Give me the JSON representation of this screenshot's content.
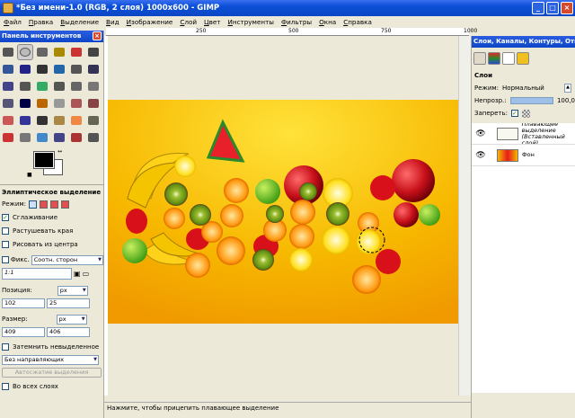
{
  "window": {
    "title": "*Без имени-1.0 (RGB, 2 слоя) 1000x600 - GIMP"
  },
  "menu": [
    "Файл",
    "Правка",
    "Выделение",
    "Вид",
    "Изображение",
    "Слой",
    "Цвет",
    "Инструменты",
    "Фильтры",
    "Окна",
    "Справка"
  ],
  "ruler": {
    "ticks": [
      "250",
      "500",
      "750",
      "1000"
    ]
  },
  "toolbox": {
    "title": "Панель инструментов",
    "icons": [
      "rect-select-icon",
      "ellipse-select-icon",
      "lasso-icon",
      "fuzzy-select-icon",
      "color-select-icon",
      "scissors-icon",
      "foreground-select-icon",
      "paths-icon",
      "color-picker-icon",
      "zoom-icon",
      "measure-icon",
      "move-icon",
      "align-icon",
      "crop-icon",
      "rotate-icon",
      "scale-icon",
      "shear-icon",
      "perspective-icon",
      "flip-icon",
      "text-icon",
      "bucket-fill-icon",
      "blend-icon",
      "pencil-icon",
      "paintbrush-icon",
      "eraser-icon",
      "airbrush-icon",
      "ink-icon",
      "clone-icon",
      "heal-icon",
      "perspective-clone-icon",
      "smudge-icon",
      "dodge-burn-icon",
      "blur-icon",
      "convolve-icon",
      "cage-icon",
      "warp-icon"
    ]
  },
  "tool_options": {
    "title": "Эллиптическое выделение",
    "mode_label": "Режим:",
    "antialias_label": "Сглаживание",
    "feather_label": "Растушевать края",
    "from_center_label": "Рисовать из центра",
    "fixed_label": "Фикс.",
    "fixed_value": "Соотн. сторон",
    "ratio_value": "1:1",
    "position_label": "Позиция:",
    "pos_x": "102",
    "pos_y": "25",
    "pos_unit": "px",
    "size_label": "Размер:",
    "size_w": "409",
    "size_h": "406",
    "size_unit": "px",
    "highlight_label": "Затемнить невыделенное",
    "guides_value": "Без направляющих",
    "autoshrink_label": "Автосжатие выделения",
    "all_layers_label": "Во всех слоях"
  },
  "status": {
    "text": "Нажмите, чтобы прицепить плавающее выделение"
  },
  "layers": {
    "dock_title": "Слои, Каналы, Контуры, Отме...",
    "panel_title": "Слои",
    "mode_label": "Режим:",
    "mode_value": "Нормальный",
    "opacity_label": "Непрозр.:",
    "opacity_value": "100,0",
    "opacity": 1.0,
    "lock_label": "Запереть:",
    "items": [
      {
        "name": "Плавающее выделение (Вставленный слой)"
      },
      {
        "name": "Фон"
      }
    ]
  },
  "colors": {
    "foreground": "#000000",
    "background": "#ffffff",
    "title_blue": "#0a4fd6",
    "canvas_yellow": "#f5b800"
  }
}
